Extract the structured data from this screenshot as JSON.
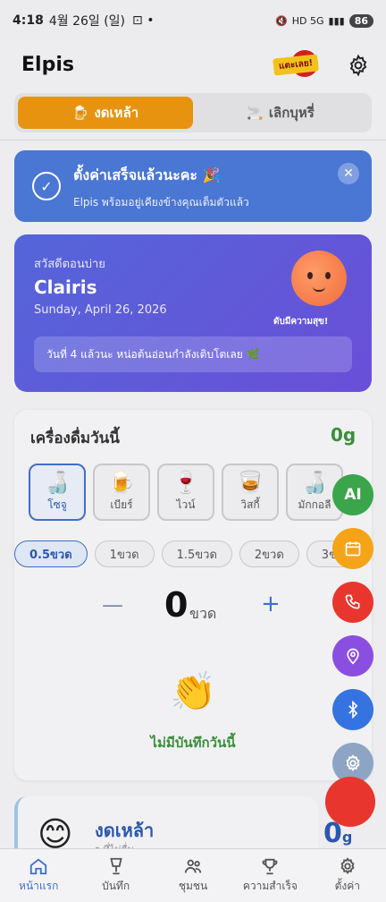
{
  "status_bar": {
    "time": "4:18",
    "date": "4월 26일 (일)",
    "signal": "HD 5G",
    "battery": "86"
  },
  "header": {
    "title": "Elpis",
    "promo_label": "แตะเลย!"
  },
  "mode_tabs": [
    {
      "label": "งดเหล้า",
      "icon": "beer-icon",
      "active": true
    },
    {
      "label": "เลิกบุหรี่",
      "icon": "cigarette-icon",
      "active": false
    }
  ],
  "toast": {
    "title": "ตั้งค่าเสร็จแล้วนะคะ 🎉",
    "subtitle": "Elpis พร้อมอยู่เคียงข้างคุณเต็มตัวแล้ว",
    "close": "✕"
  },
  "greeting": {
    "hello": "สวัสดีตอนบ่าย",
    "name": "Clairis",
    "date": "Sunday, April 26, 2026",
    "mascot_caption": "ดับมีความสุข!",
    "streak": "วันที่ 4 แล้วนะ หน่อต้นอ่อนกำลังเติบโตเลย 🌿"
  },
  "drinks": {
    "title": "เครื่องดื่มวันนี้",
    "total": "0g",
    "types": [
      {
        "label": "โซจู",
        "icon": "🍶",
        "selected": true
      },
      {
        "label": "เบียร์",
        "icon": "🍺",
        "selected": false
      },
      {
        "label": "ไวน์",
        "icon": "🍷",
        "selected": false
      },
      {
        "label": "วิสกี้",
        "icon": "🥃",
        "selected": false
      },
      {
        "label": "มักกอลี",
        "icon": "🍶",
        "selected": false
      }
    ],
    "amounts": [
      {
        "label": "0.5ขวด",
        "selected": true
      },
      {
        "label": "1ขวด",
        "selected": false
      },
      {
        "label": "1.5ขวด",
        "selected": false
      },
      {
        "label": "2ขวด",
        "selected": false
      },
      {
        "label": "3ขวด",
        "selected": false
      }
    ],
    "count": "0",
    "unit": "ขวด",
    "minus": "—",
    "plus": "+",
    "empty_icon": "👏",
    "empty_text": "ไม่มีบันทึกวันนี้"
  },
  "fabs": [
    {
      "label": "AI",
      "icon": "ai-icon",
      "color": "#3aa54a"
    },
    {
      "label": "",
      "icon": "calendar-icon",
      "color": "#f5a418"
    },
    {
      "label": "",
      "icon": "phone-icon",
      "color": "#e8362e"
    },
    {
      "label": "",
      "icon": "location-icon",
      "color": "#8a4fe0"
    },
    {
      "label": "",
      "icon": "bluetooth-icon",
      "color": "#3574e0"
    },
    {
      "label": "",
      "icon": "gear-icon",
      "color": "#8ea4c4"
    }
  ],
  "sobriety": {
    "title": "งดเหล้า",
    "subtitle": "ๆ ที่ไม่ดื่ม",
    "value": "0",
    "unit": "g",
    "face": "😊"
  },
  "bottom_nav": [
    {
      "label": "หน้าแรก",
      "icon": "home-icon",
      "active": true
    },
    {
      "label": "บันทึก",
      "icon": "glass-icon",
      "active": false
    },
    {
      "label": "ชุมชน",
      "icon": "people-icon",
      "active": false
    },
    {
      "label": "ความสำเร็จ",
      "icon": "trophy-icon",
      "active": false
    },
    {
      "label": "ตั้งค่า",
      "icon": "gear-icon",
      "active": false
    }
  ]
}
